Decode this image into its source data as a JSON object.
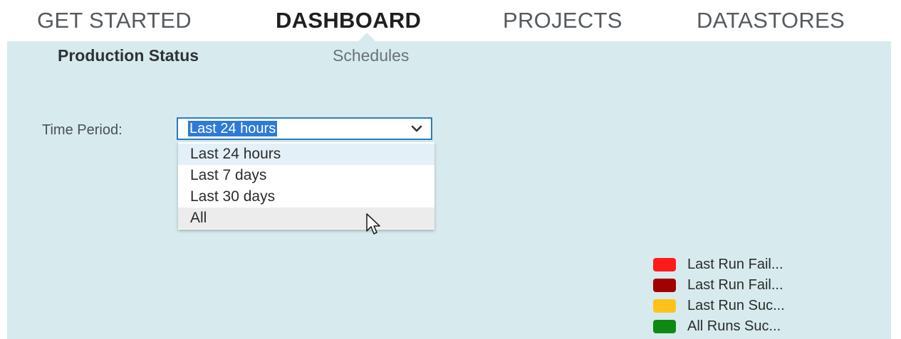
{
  "topnav": {
    "items": [
      {
        "label": "GET STARTED",
        "active": false
      },
      {
        "label": "DASHBOARD",
        "active": true
      },
      {
        "label": "PROJECTS",
        "active": false
      },
      {
        "label": "DATASTORES",
        "active": false
      }
    ]
  },
  "subtabs": [
    {
      "label": "Production Status",
      "active": true
    },
    {
      "label": "Schedules",
      "active": false
    }
  ],
  "time_period": {
    "label": "Time Period:",
    "selected": "Last 24 hours",
    "options": [
      "Last 24 hours",
      "Last 7 days",
      "Last 30 days",
      "All"
    ],
    "hovered_option": "All"
  },
  "legend": [
    {
      "label": "Last Run Fail...",
      "color": "#ff1a1a"
    },
    {
      "label": "Last Run Fail...",
      "color": "#a30000"
    },
    {
      "label": "Last Run Suc...",
      "color": "#ffc21a"
    },
    {
      "label": "All Runs Suc...",
      "color": "#0e8a14"
    }
  ],
  "icons": {
    "select_chevron": "chevron-down-icon",
    "mouse_cursor": "mouse-pointer-icon"
  }
}
